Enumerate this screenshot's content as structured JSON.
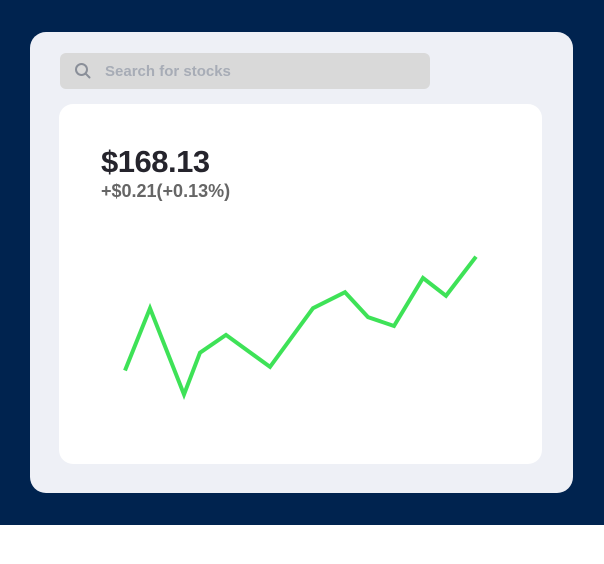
{
  "search": {
    "placeholder": "Search for stocks",
    "icon": "search-icon"
  },
  "quote": {
    "price": "$168.13",
    "change": "+$0.21(+0.13%)"
  },
  "colors": {
    "background": "#00234f",
    "window": "#eef0f6",
    "card": "#ffffff",
    "line": "#3ee257"
  },
  "chart_data": {
    "type": "line",
    "title": "",
    "xlabel": "",
    "ylabel": "",
    "x": [
      0,
      1,
      2,
      3,
      4,
      5,
      6,
      7,
      8,
      9,
      10,
      11,
      12
    ],
    "values": [
      10,
      45,
      -3.5,
      20,
      30,
      12,
      45,
      54,
      40,
      35,
      62,
      52,
      74
    ],
    "ylim": [
      -10,
      80
    ]
  }
}
